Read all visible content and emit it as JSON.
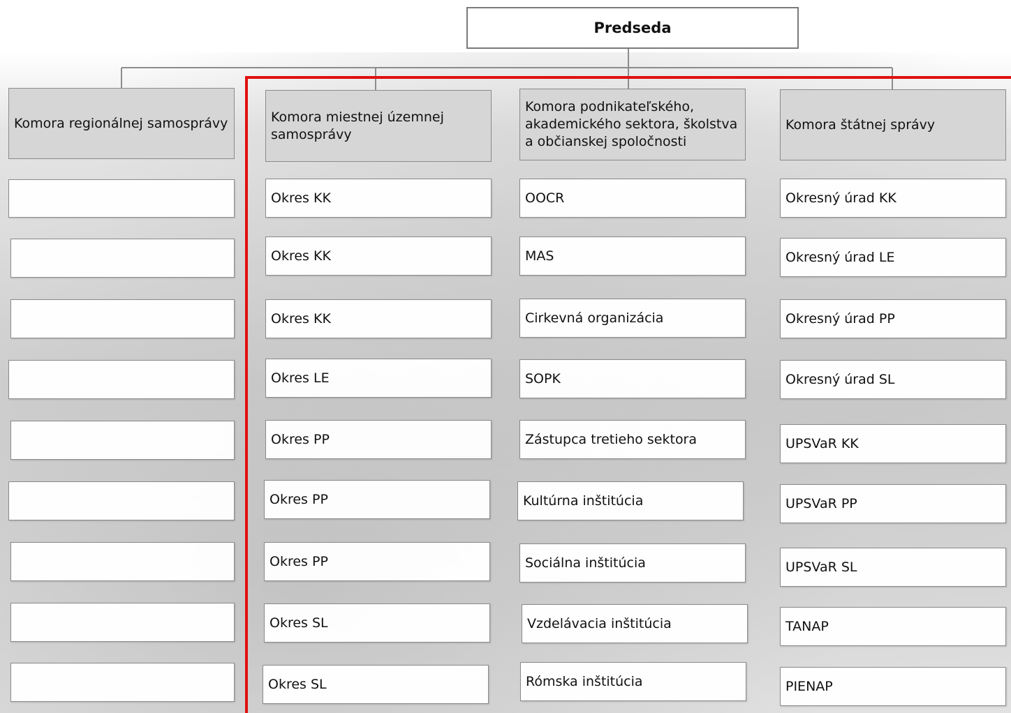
{
  "chairman": "Predseda",
  "chambers": [
    {
      "header": "Komora regionálnej samosprávy",
      "items": [
        "",
        "",
        "",
        "",
        "",
        "",
        "",
        "",
        ""
      ]
    },
    {
      "header": "Komora miestnej územnej samosprávy",
      "items": [
        "Okres KK",
        "Okres KK",
        "Okres KK",
        "Okres LE",
        "Okres PP",
        "Okres PP",
        "Okres PP",
        "Okres SL",
        "Okres SL"
      ]
    },
    {
      "header": "Komora podnikateľského, akademického sektora, školstva a občianskej spoločnosti",
      "items": [
        "OOCR",
        "MAS",
        "Cirkevná organizácia",
        "SOPK",
        "Zástupca tretieho sektora",
        "Kultúrna inštitúcia",
        "Sociálna inštitúcia",
        "Vzdelávacia inštitúcia",
        "Rómska inštitúcia"
      ]
    },
    {
      "header": "Komora štátnej správy",
      "items": [
        "Okresný úrad KK",
        "Okresný úrad LE",
        "Okresný úrad PP",
        "Okresný úrad SL",
        "UPSVaR KK",
        "UPSVaR PP",
        "UPSVaR SL",
        "TANAP",
        "PIENAP"
      ]
    }
  ]
}
